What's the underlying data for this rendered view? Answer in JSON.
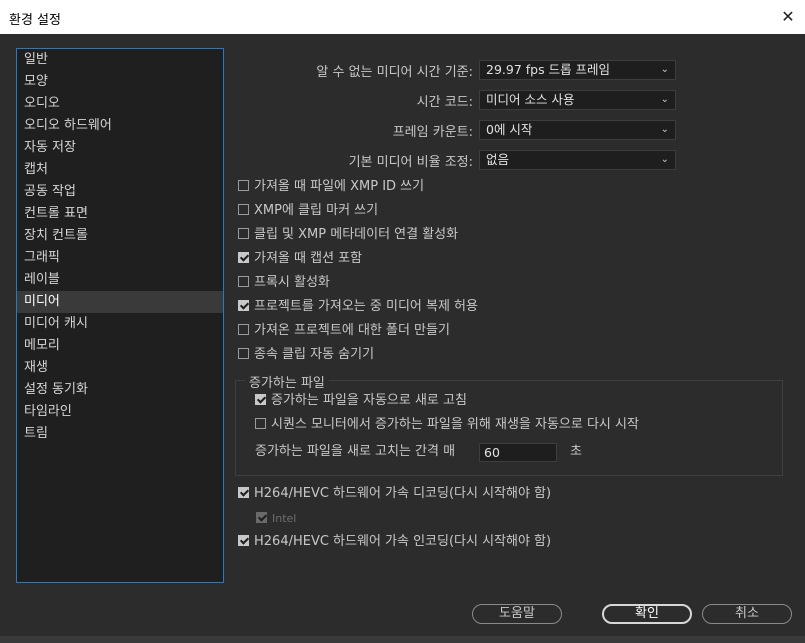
{
  "window": {
    "title": "환경 설정",
    "close_glyph": "✕"
  },
  "sidebar": {
    "items": [
      {
        "label": "일반"
      },
      {
        "label": "모양"
      },
      {
        "label": "오디오"
      },
      {
        "label": "오디오 하드웨어"
      },
      {
        "label": "자동 저장"
      },
      {
        "label": "캡처"
      },
      {
        "label": "공동 작업"
      },
      {
        "label": "컨트롤 표면"
      },
      {
        "label": "장치 컨트롤"
      },
      {
        "label": "그래픽"
      },
      {
        "label": "레이블"
      },
      {
        "label": "미디어",
        "selected": true
      },
      {
        "label": "미디어 캐시"
      },
      {
        "label": "메모리"
      },
      {
        "label": "재생"
      },
      {
        "label": "설정 동기화"
      },
      {
        "label": "타임라인"
      },
      {
        "label": "트림"
      }
    ]
  },
  "media": {
    "timebase_label": "알 수 없는 미디어 시간 기준:",
    "timebase_value": "29.97 fps 드롭 프레임",
    "timecode_label": "시간 코드:",
    "timecode_value": "미디어 소스 사용",
    "frame_count_label": "프레임 카운트:",
    "frame_count_value": "0에 시작",
    "scale_label": "기본 미디어 비율 조정:",
    "scale_value": "없음",
    "checkboxes": [
      {
        "label": "가져올 때 파일에 XMP ID 쓰기",
        "checked": false
      },
      {
        "label": "XMP에 클립 마커 쓰기",
        "checked": false
      },
      {
        "label": "클립 및 XMP 메타데이터 연결 활성화",
        "checked": false
      },
      {
        "label": "가져올 때 캡션 포함",
        "checked": true
      },
      {
        "label": "프록시 활성화",
        "checked": false
      },
      {
        "label": "프로젝트를 가져오는 중 미디어 복제 허용",
        "checked": true
      },
      {
        "label": "가져온 프로젝트에 대한 폴더 만들기",
        "checked": false
      },
      {
        "label": "종속 클립 자동 숨기기",
        "checked": false
      }
    ],
    "growing": {
      "title": "증가하는 파일",
      "auto_refresh_label": "증가하는 파일을 자동으로 새로 고침",
      "auto_refresh_checked": true,
      "restart_label": "시퀀스 모니터에서 증가하는 파일을 위해 재생을 자동으로 다시 시작",
      "restart_checked": false,
      "interval_label": "증가하는 파일을 새로 고치는 간격 매",
      "interval_value": "60",
      "interval_unit": "초"
    },
    "hw_decode_label": "H264/HEVC 하드웨어 가속 디코딩(다시 시작해야 함)",
    "hw_decode_checked": true,
    "intel_label": "Intel",
    "intel_checked": true,
    "hw_encode_label": "H264/HEVC 하드웨어 가속 인코딩(다시 시작해야 함)",
    "hw_encode_checked": true
  },
  "buttons": {
    "help": "도움말",
    "ok": "확인",
    "cancel": "취소"
  },
  "icons": {
    "dropdown": "chevron-down-icon",
    "checkbox": "checkbox-icon"
  }
}
